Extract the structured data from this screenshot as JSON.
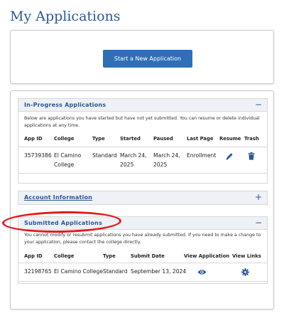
{
  "page_title": "My Applications",
  "start_button_label": "Start a New Application",
  "in_progress": {
    "title": "In-Progress Applications",
    "toggle": "−",
    "description": "Below are applications you have started but have not yet submitted. You can resume or delete individual applications at any time.",
    "columns": [
      "App ID",
      "College",
      "Type",
      "Started",
      "Paused",
      "Last Page",
      "Resume",
      "Trash"
    ],
    "rows": [
      {
        "app_id": "35739386",
        "college": "El Camino College",
        "type": "Standard",
        "started": "March 24, 2025",
        "paused": "March 24, 2025",
        "last_page": "Enrollment",
        "resume_icon": "pencil-icon",
        "trash_icon": "trash-icon"
      }
    ]
  },
  "account_info": {
    "title": "Account Information",
    "toggle": "+"
  },
  "submitted": {
    "title": "Submitted Applications",
    "toggle": "−",
    "description": "You cannot modify or resubmit applications you have already submitted. If you need to make a change to your application, please contact the college directly.",
    "columns": [
      "App ID",
      "College",
      "Type",
      "Submit Date",
      "View Application",
      "View Links"
    ],
    "rows": [
      {
        "app_id": "32198765",
        "college": "El Camino College",
        "type": "Standard",
        "submit_date": "September 13, 2024",
        "view_icon": "eye-icon",
        "links_icon": "gear-icon"
      }
    ]
  },
  "colors": {
    "brand_blue": "#2b5797",
    "button_blue": "#2f6fb6",
    "annotation_red": "#e21b1b"
  }
}
